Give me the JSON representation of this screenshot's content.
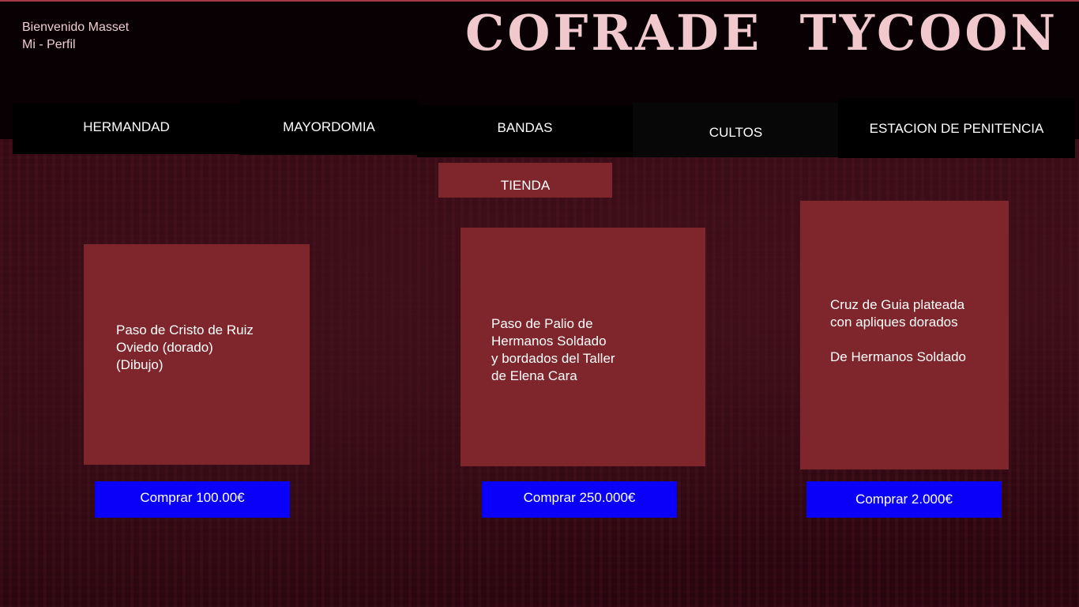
{
  "header": {
    "greeting": "Bienvenido Masset",
    "profile_link": "Mi - Perfil",
    "title": "COFRADE  TYCOON"
  },
  "nav": {
    "hermandad": "HERMANDAD",
    "mayordomia": "MAYORDOMIA",
    "bandas": "BANDAS",
    "cultos": "CULTOS",
    "estacion": "ESTACION DE PENITENCIA",
    "tienda": "TIENDA"
  },
  "products": [
    {
      "description": "Paso de Cristo de Ruiz\nOviedo (dorado)\n(Dibujo)",
      "buy_label": "Comprar 100.00€"
    },
    {
      "description": "Paso de Palio de\nHermanos Soldado\ny bordados del Taller\nde Elena Cara",
      "buy_label": "Comprar 250.000€"
    },
    {
      "description": "Cruz de Guia plateada\ncon apliques dorados\n\nDe Hermanos Soldado",
      "buy_label": "Comprar 2.000€"
    }
  ],
  "colors": {
    "header_bg": "#080002",
    "title": "#f0c8cd",
    "card_bg": "#7e262b",
    "buy_button": "#0a00fa"
  }
}
